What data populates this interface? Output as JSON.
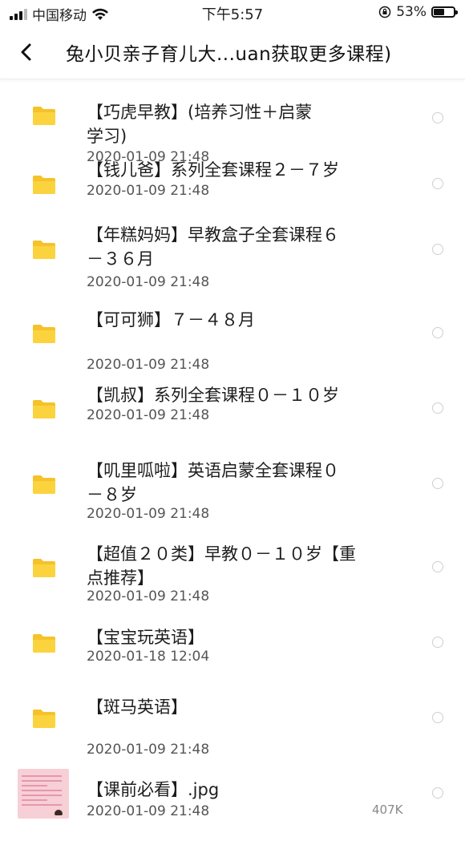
{
  "status_bar": {
    "carrier": "中国移动",
    "time": "下午5:57",
    "battery_percent": "53%",
    "battery_level": 0.53,
    "icons": [
      "signal-icon",
      "wifi-icon",
      "orientation-lock-icon",
      "battery-icon"
    ]
  },
  "nav": {
    "back_icon": "chevron-left-icon",
    "title": "兔小贝亲子育儿大...uan获取更多课程)"
  },
  "files": [
    {
      "icon": "folder-icon",
      "name_lines": [
        "【巧虎早教】(培养习性＋启蒙",
        "学习)"
      ],
      "date": "2020-01-09 21:48"
    },
    {
      "icon": "folder-icon",
      "name_lines": [
        "【钱儿爸】系列全套课程２－７岁"
      ],
      "date": "2020-01-09 21:48"
    },
    {
      "icon": "folder-icon",
      "name_lines": [
        "【年糕妈妈】早教盒子全套课程６",
        "－３６月"
      ],
      "date": "2020-01-09 21:48"
    },
    {
      "icon": "folder-icon",
      "name_lines": [
        "【可可狮】７－４８月"
      ],
      "date": "2020-01-09 21:48"
    },
    {
      "icon": "folder-icon",
      "name_lines": [
        "【凯叔】系列全套课程０－１０岁"
      ],
      "date": "2020-01-09 21:48"
    },
    {
      "icon": "folder-icon",
      "name_lines": [
        "【叽里呱啦】英语启蒙全套课程０",
        "－８岁"
      ],
      "date": "2020-01-09 21:48"
    },
    {
      "icon": "folder-icon",
      "name_lines": [
        "【超值２０类】早教０－１０岁【重",
        "点推荐】"
      ],
      "date": "2020-01-09 21:48"
    },
    {
      "icon": "folder-icon",
      "name_lines": [
        "【宝宝玩英语】"
      ],
      "date": "2020-01-18 12:04"
    },
    {
      "icon": "folder-icon",
      "name_lines": [
        "【斑马英语】"
      ],
      "date": "2020-01-09 21:48"
    },
    {
      "icon": "image-thumbnail",
      "name_lines": [
        "【课前必看】.jpg"
      ],
      "date": "2020-01-09 21:48",
      "size": "407K"
    }
  ]
}
